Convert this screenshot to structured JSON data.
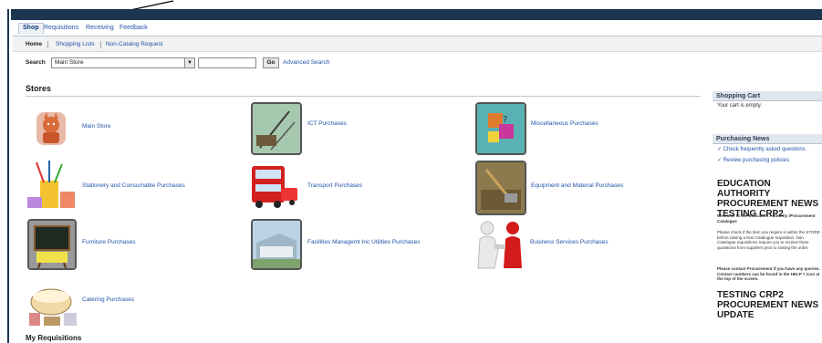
{
  "tabs": [
    {
      "label": "Shop",
      "active": true
    },
    {
      "label": "Requisitions"
    },
    {
      "label": "Receiving"
    },
    {
      "label": "Feedback"
    }
  ],
  "subnav": [
    {
      "label": "Home",
      "active": true
    },
    {
      "label": "Shopping Lists"
    },
    {
      "label": "Non-Catalog Request"
    }
  ],
  "search": {
    "label": "Search",
    "selected": "Main Store",
    "go_label": "Go",
    "advanced_label": "Advanced Search"
  },
  "stores": {
    "title": "Stores",
    "items": [
      {
        "label": "Main Store",
        "icon": "fox-mascot-icon"
      },
      {
        "label": "ICT Purchases",
        "icon": "cables-icon"
      },
      {
        "label": "Miscellaneous Purchases",
        "icon": "puzzle-icon"
      },
      {
        "label": "Stationery and Consumable Purchases",
        "icon": "stationery-icon"
      },
      {
        "label": "Transport Purchases",
        "icon": "bus-icon"
      },
      {
        "label": "Equipment and Material Purchases",
        "icon": "shovel-icon"
      },
      {
        "label": "Furniture Purchases",
        "icon": "blackboard-icon"
      },
      {
        "label": "Facilities Managemt Inc Utilities Purchases",
        "icon": "building-icon"
      },
      {
        "label": "Business Services Purchases",
        "icon": "handshake-icon"
      },
      {
        "label": "Catering Purchases",
        "icon": "baking-icon"
      }
    ]
  },
  "cart": {
    "title": "Shopping Cart",
    "empty_text": "Your cart is empty."
  },
  "news": {
    "title": "Purchasing News",
    "links": [
      "Check frequently asked questions",
      "Review purchasing policies"
    ],
    "headline": "EDUCATION AUTHORITY PROCUREMENT NEWS TESTING CRP2",
    "welcome": "Welcome to the Education Authority iProcurement Catalogue",
    "body1": "Please check if the item you require is within the STORE before raising a Non Catalogue requisition. Non Catalogue requisitions require you to receive three quotations from suppliers prior to raising the order.",
    "body2": "Please contact Procurement if you have any queries. Contact numbers can be found in the HELP ? icon at the top of the screen.",
    "update_headline": "TESTING CRP2 PROCUREMENT NEWS UPDATE"
  },
  "my_requisitions": {
    "title": "My Requisitions"
  },
  "colors": {
    "dark_bar": "#1d3650",
    "link": "#2153a8",
    "side_header": "#dfe6ee"
  }
}
